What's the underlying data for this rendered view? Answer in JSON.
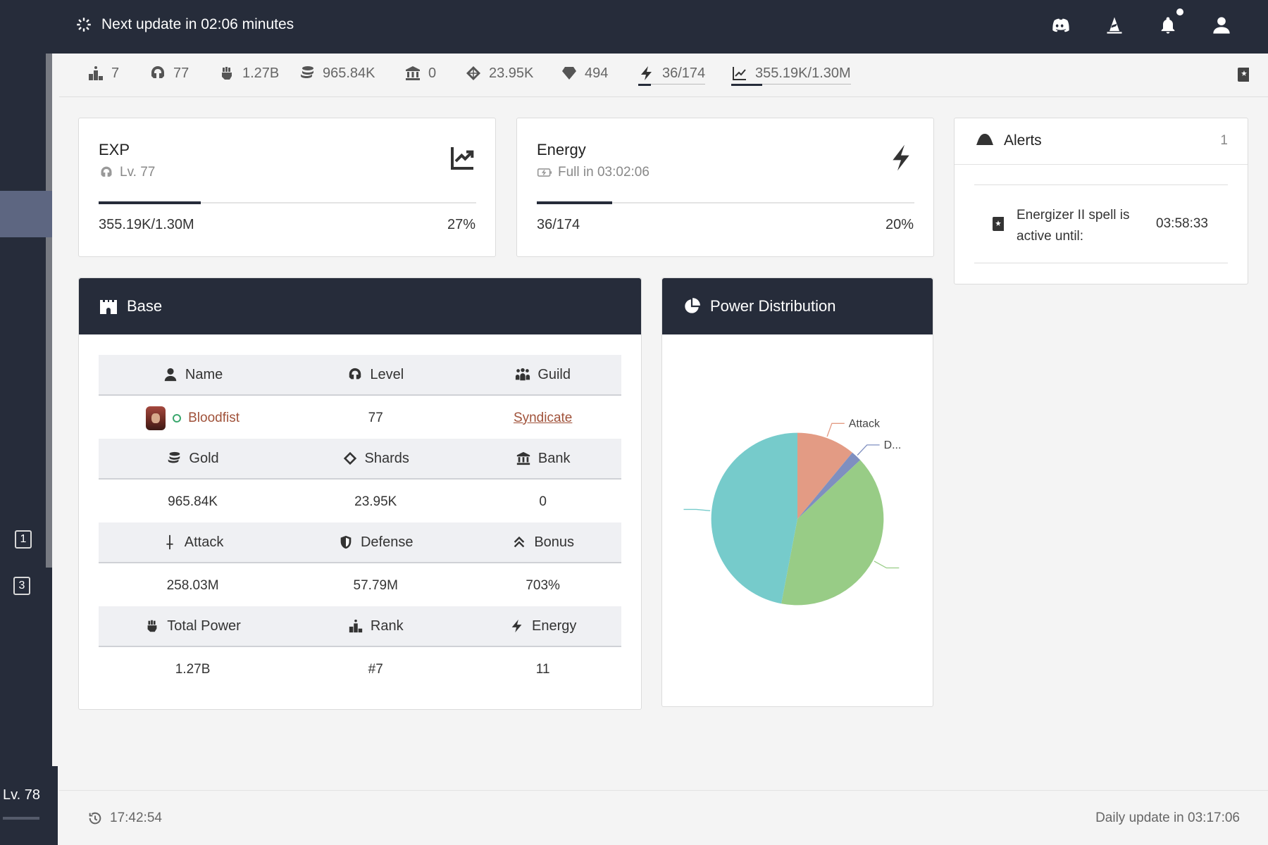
{
  "topbar": {
    "update_text": "Next update in 02:06 minutes",
    "icons": [
      "discord-icon",
      "wizard-hat-icon",
      "bell-icon",
      "user-icon"
    ]
  },
  "sidebar": {
    "pages": [
      "1",
      "3"
    ],
    "level": "Lv. 78"
  },
  "stats": {
    "rank": "7",
    "level": "77",
    "power": "1.27B",
    "gold": "965.84K",
    "bank": "0",
    "shards": "23.95K",
    "gems": "494",
    "energy": "36/174",
    "exp": "355.19K/1.30M"
  },
  "exp_card": {
    "title": "EXP",
    "sub": "Lv. 77",
    "value": "355.19K/1.30M",
    "percent_label": "27%",
    "progress": 0.27
  },
  "energy_card": {
    "title": "Energy",
    "sub": "Full in 03:02:06",
    "value": "36/174",
    "percent_label": "20%",
    "progress": 0.2
  },
  "alerts": {
    "title": "Alerts",
    "count": "1",
    "items": [
      {
        "message": "Energizer II spell is active until:",
        "time": "03:58:33"
      }
    ]
  },
  "base": {
    "title": "Base",
    "headers1": [
      "Name",
      "Level",
      "Guild"
    ],
    "row1": {
      "name": "Bloodfist",
      "level": "77",
      "guild": "Syndicate"
    },
    "headers2": [
      "Gold",
      "Shards",
      "Bank"
    ],
    "row2": [
      "965.84K",
      "23.95K",
      "0"
    ],
    "headers3": [
      "Attack",
      "Defense",
      "Bonus"
    ],
    "row3": [
      "258.03M",
      "57.79M",
      "703%"
    ],
    "headers4": [
      "Total Power",
      "Rank",
      "Energy"
    ],
    "row4": [
      "1.27B",
      "#7",
      "11"
    ]
  },
  "power": {
    "title": "Power Distribution"
  },
  "chart_data": {
    "type": "pie",
    "slices": [
      {
        "label": "Attack",
        "value": 11,
        "color": "#e39b84"
      },
      {
        "label": "D...",
        "value": 2,
        "color": "#7f8fc0"
      },
      {
        "label": "",
        "value": 40,
        "color": "#98cc86"
      },
      {
        "label": "",
        "value": 47,
        "color": "#76cbcb"
      }
    ]
  },
  "footer": {
    "time": "17:42:54",
    "daily": "Daily update in 03:17:06"
  },
  "colors": {
    "dark": "#262c3a",
    "accent_name": "#a0523a",
    "online": "#3aa76d"
  }
}
